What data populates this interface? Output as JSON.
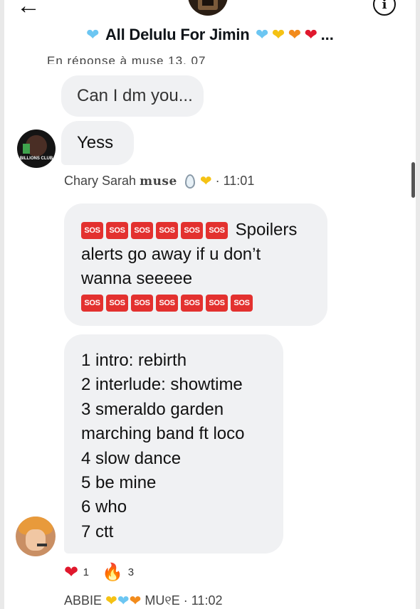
{
  "header": {
    "back_icon": "arrow-left-icon",
    "info_icon": "info-icon",
    "info_glyph": "i",
    "title": "All Delulu For Jimin",
    "title_hearts_before": [
      "blue"
    ],
    "title_hearts_after": [
      "blue",
      "yellow",
      "orange",
      "red"
    ],
    "ellipsis": "...",
    "quoted_reply_partial": "En réponse à muse 13, 07 "
  },
  "messages": [
    {
      "text": "Can I dm you..."
    },
    {
      "text": "Yess"
    }
  ],
  "avatar1_text": "BILLIONS CLUB",
  "meta1": {
    "name": "Chary Sarah",
    "muse": "muse",
    "time": "· 11:01"
  },
  "spoiler": {
    "sos_label": "SOS",
    "line1": "Spoilers",
    "line2": "alerts go away if u don’t",
    "line3": "wanna seeeee"
  },
  "tracklist": [
    "1 intro: rebirth",
    "2 interlude: showtime",
    "3 smeraldo garden",
    "marching band ft loco",
    "4 slow dance",
    "5 be mine",
    "6 who",
    "7 ctt"
  ],
  "reactions": [
    {
      "icon": "red-heart-icon",
      "count": "1"
    },
    {
      "icon": "fire-icon",
      "count": "3"
    }
  ],
  "meta2": {
    "name": "ABBIE",
    "muse": "MU୧E",
    "time": "· 11:02"
  },
  "colors": {
    "bubble": "#f0f1f3",
    "sos": "#e3312f",
    "heart_blue": "#6cc6f2",
    "heart_yellow": "#f5c214",
    "heart_orange": "#f28b1c",
    "heart_red": "#e0182d"
  }
}
